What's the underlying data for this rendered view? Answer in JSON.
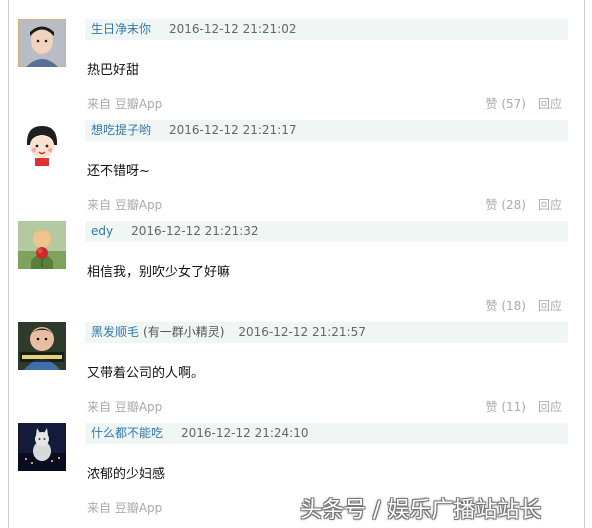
{
  "comments": [
    {
      "author": "生日净末你",
      "note": "",
      "time": "2016-12-12 21:21:02",
      "text": "热巴好甜",
      "source_prefix": "来自",
      "source_app": "豆瓣App",
      "vote": "赞 (57)",
      "reply": "回应",
      "avatar_icon": "boy-portrait"
    },
    {
      "author": "想吃提子哟",
      "note": "",
      "time": "2016-12-12 21:21:17",
      "text": "还不错呀~",
      "source_prefix": "来自",
      "source_app": "豆瓣App",
      "vote": "赞 (28)",
      "reply": "回应",
      "avatar_icon": "cartoon-girl"
    },
    {
      "author": "edy",
      "note": "",
      "time": "2016-12-12 21:21:32",
      "text": "相信我，别吹少女了好嘛",
      "source_prefix": "",
      "source_app": "",
      "vote": "赞 (18)",
      "reply": "回应",
      "avatar_icon": "little-prince-rose"
    },
    {
      "author": "黑发顺毛",
      "note": "(有一群小精灵)",
      "time": "2016-12-12 21:21:57",
      "text": "又带着公司的人啊。",
      "source_prefix": "来自",
      "source_app": "豆瓣App",
      "vote": "赞 (11)",
      "reply": "回应",
      "avatar_icon": "kid-meme"
    },
    {
      "author": "什么都不能吃",
      "note": "",
      "time": "2016-12-12 21:24:10",
      "text": "浓郁的少妇感",
      "source_prefix": "来自",
      "source_app": "豆瓣App",
      "vote": "",
      "reply": "",
      "avatar_icon": "cat-night-city"
    }
  ],
  "watermark": "头条号 / 娱乐广播站站长"
}
